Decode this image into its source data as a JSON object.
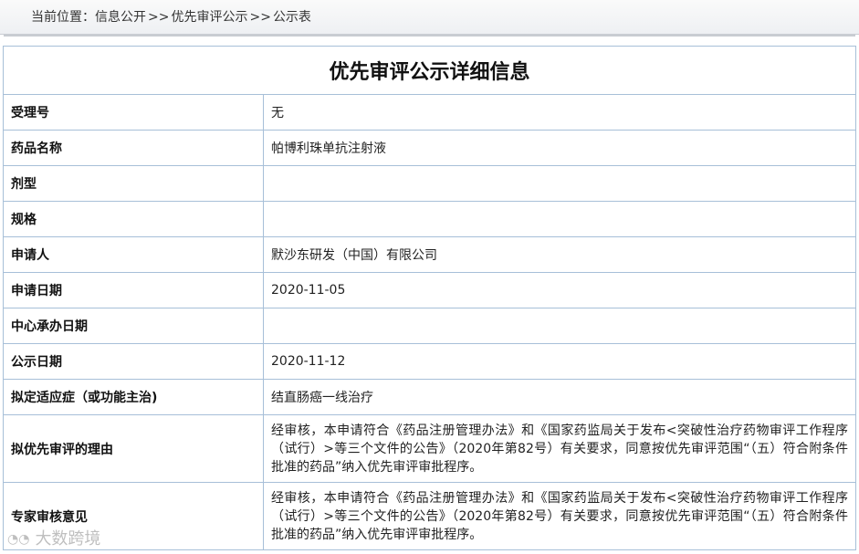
{
  "breadcrumb": {
    "prefix": "当前位置：",
    "items": [
      "信息公开",
      "优先审评公示",
      "公示表"
    ],
    "separator": ">>"
  },
  "title": "优先审评公示详细信息",
  "rows": [
    {
      "label": "受理号",
      "value": "无"
    },
    {
      "label": "药品名称",
      "value": "帕博利珠单抗注射液"
    },
    {
      "label": "剂型",
      "value": ""
    },
    {
      "label": "规格",
      "value": ""
    },
    {
      "label": "申请人",
      "value": "默沙东研发（中国）有限公司"
    },
    {
      "label": "申请日期",
      "value": "2020-11-05"
    },
    {
      "label": "中心承办日期",
      "value": ""
    },
    {
      "label": "公示日期",
      "value": "2020-11-12"
    },
    {
      "label": "拟定适应症（或功能主治)",
      "value": "结直肠癌一线治疗"
    },
    {
      "label": "拟优先审评的理由",
      "value": "经审核，本申请符合《药品注册管理办法》和《国家药监局关于发布<突破性治疗药物审评工作程序（试行）>等三个文件的公告》（2020年第82号）有关要求，同意按优先审评范围“（五）符合附条件批准的药品”纳入优先审评审批程序。"
    },
    {
      "label": "专家审核意见",
      "value": "经审核，本申请符合《药品注册管理办法》和《国家药监局关于发布<突破性治疗药物审评工作程序（试行）>等三个文件的公告》（2020年第82号）有关要求，同意按优先审评范围“（五）符合附条件批准的药品”纳入优先审评审批程序。"
    }
  ],
  "watermark": "大数跨境"
}
